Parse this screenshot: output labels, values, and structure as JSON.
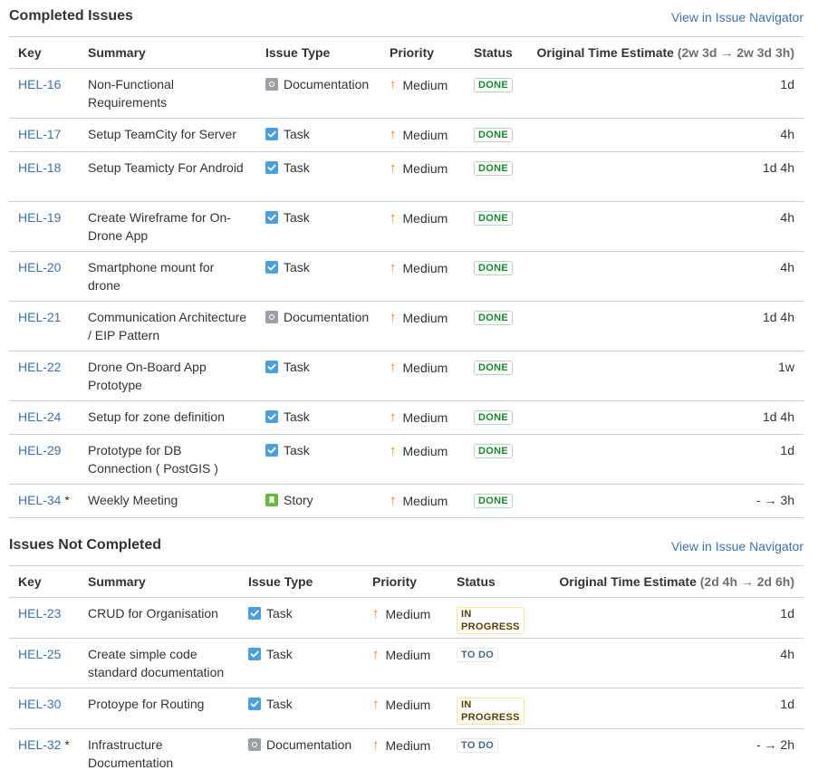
{
  "colors": {
    "link": "#3b73af",
    "done": "#14892c",
    "in_progress": "#594300",
    "to_do": "#4a6785",
    "priority_medium": "#f07a12",
    "task_icon": "#4a9fe0",
    "story_icon": "#63ba3c",
    "doc_icon": "#9aa0a6"
  },
  "completed": {
    "title": "Completed Issues",
    "nav_link": "View in Issue Navigator",
    "headers": {
      "key": "Key",
      "summary": "Summary",
      "type": "Issue Type",
      "priority": "Priority",
      "status": "Status",
      "estimate": "Original Time Estimate",
      "estimate_range": "(2w 3d → 2w 3d 3h)"
    },
    "rows": [
      {
        "key": "HEL-16",
        "star": "",
        "summary": "Non-Functional Requirements",
        "type": "Documentation",
        "type_icon": "doc-icon",
        "priority": "Medium",
        "status": "DONE",
        "estimate": "1d"
      },
      {
        "key": "HEL-17",
        "star": "",
        "summary": "Setup TeamCity for Server",
        "type": "Task",
        "type_icon": "task-icon",
        "priority": "Medium",
        "status": "DONE",
        "estimate": "4h"
      },
      {
        "key": "HEL-18",
        "star": "",
        "summary": "Setup Teamicty For Android",
        "type": "Task",
        "type_icon": "task-icon",
        "priority": "Medium",
        "status": "DONE",
        "estimate": "1d 4h"
      },
      {
        "key": "HEL-19",
        "star": "",
        "summary": "Create Wireframe for On-Drone App",
        "type": "Task",
        "type_icon": "task-icon",
        "priority": "Medium",
        "status": "DONE",
        "estimate": "4h"
      },
      {
        "key": "HEL-20",
        "star": "",
        "summary": "Smartphone mount for drone",
        "type": "Task",
        "type_icon": "task-icon",
        "priority": "Medium",
        "status": "DONE",
        "estimate": "4h"
      },
      {
        "key": "HEL-21",
        "star": "",
        "summary": "Communication Architecture / EIP Pattern",
        "type": "Documentation",
        "type_icon": "doc-icon",
        "priority": "Medium",
        "status": "DONE",
        "estimate": "1d 4h"
      },
      {
        "key": "HEL-22",
        "star": "",
        "summary": "Drone On-Board App Prototype",
        "type": "Task",
        "type_icon": "task-icon",
        "priority": "Medium",
        "status": "DONE",
        "estimate": "1w"
      },
      {
        "key": "HEL-24",
        "star": "",
        "summary": "Setup for zone definition",
        "type": "Task",
        "type_icon": "task-icon",
        "priority": "Medium",
        "status": "DONE",
        "estimate": "1d 4h"
      },
      {
        "key": "HEL-29",
        "star": "",
        "summary": "Prototype for DB Connection ( PostGIS )",
        "type": "Task",
        "type_icon": "task-icon",
        "priority": "Medium",
        "status": "DONE",
        "estimate": "1d"
      },
      {
        "key": "HEL-34",
        "star": "*",
        "summary": "Weekly Meeting",
        "type": "Story",
        "type_icon": "story-icon",
        "priority": "Medium",
        "status": "DONE",
        "estimate": "- → 3h"
      }
    ]
  },
  "not_completed": {
    "title": "Issues Not Completed",
    "nav_link": "View in Issue Navigator",
    "headers": {
      "key": "Key",
      "summary": "Summary",
      "type": "Issue Type",
      "priority": "Priority",
      "status": "Status",
      "estimate": "Original Time Estimate",
      "estimate_range": "(2d 4h → 2d 6h)"
    },
    "rows": [
      {
        "key": "HEL-23",
        "star": "",
        "summary": "CRUD for Organisation",
        "type": "Task",
        "type_icon": "task-icon",
        "priority": "Medium",
        "status": "IN PROGRESS",
        "estimate": "1d"
      },
      {
        "key": "HEL-25",
        "star": "",
        "summary": "Create simple code standard documentation",
        "type": "Task",
        "type_icon": "task-icon",
        "priority": "Medium",
        "status": "TO DO",
        "estimate": "4h"
      },
      {
        "key": "HEL-30",
        "star": "",
        "summary": "Protoype for Routing",
        "type": "Task",
        "type_icon": "task-icon",
        "priority": "Medium",
        "status": "IN PROGRESS",
        "estimate": "1d"
      },
      {
        "key": "HEL-32",
        "star": "*",
        "summary": "Infrastructure Documentation",
        "type": "Documentation",
        "type_icon": "doc-icon",
        "priority": "Medium",
        "status": "TO DO",
        "estimate": "- → 2h"
      }
    ]
  }
}
